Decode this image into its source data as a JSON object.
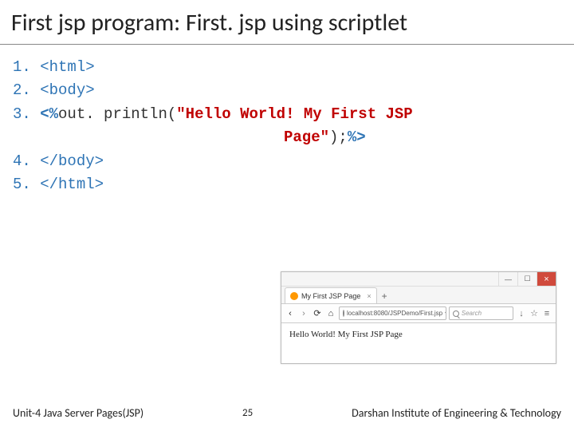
{
  "slide": {
    "title": "First jsp program: First. jsp using scriptlet"
  },
  "code": {
    "n1": "1.",
    "n2": "2.",
    "n3": "3.",
    "n4": "4.",
    "n5": "5.",
    "l1": "<html>",
    "l2": "<body>",
    "l3_open": "<%",
    "l3_code": "out. println(",
    "l3_str": "\"Hello World! My First JSP ",
    "l3b_str": "Page\"",
    "l3b_code": ");",
    "l3_close": "%>",
    "l4": "</body>",
    "l5": "</html>"
  },
  "browser": {
    "tab_title": "My First JSP Page",
    "newtab": "+",
    "tab_close": "×",
    "url": "localhost:8080/JSPDemo/First.jsp",
    "search_placeholder": "Search",
    "back": "‹",
    "forward": "›",
    "reload": "⟳",
    "home": "⌂",
    "download": "↓",
    "bookmark": "☆",
    "menu": "≡",
    "dropdown": "▾",
    "page_text": "Hello World! My First JSP Page",
    "min": "—",
    "max": "☐",
    "close": "×"
  },
  "footer": {
    "left": "Unit-4 Java Server Pages(JSP)",
    "page": "25",
    "right": "Darshan Institute of Engineering & Technology"
  }
}
